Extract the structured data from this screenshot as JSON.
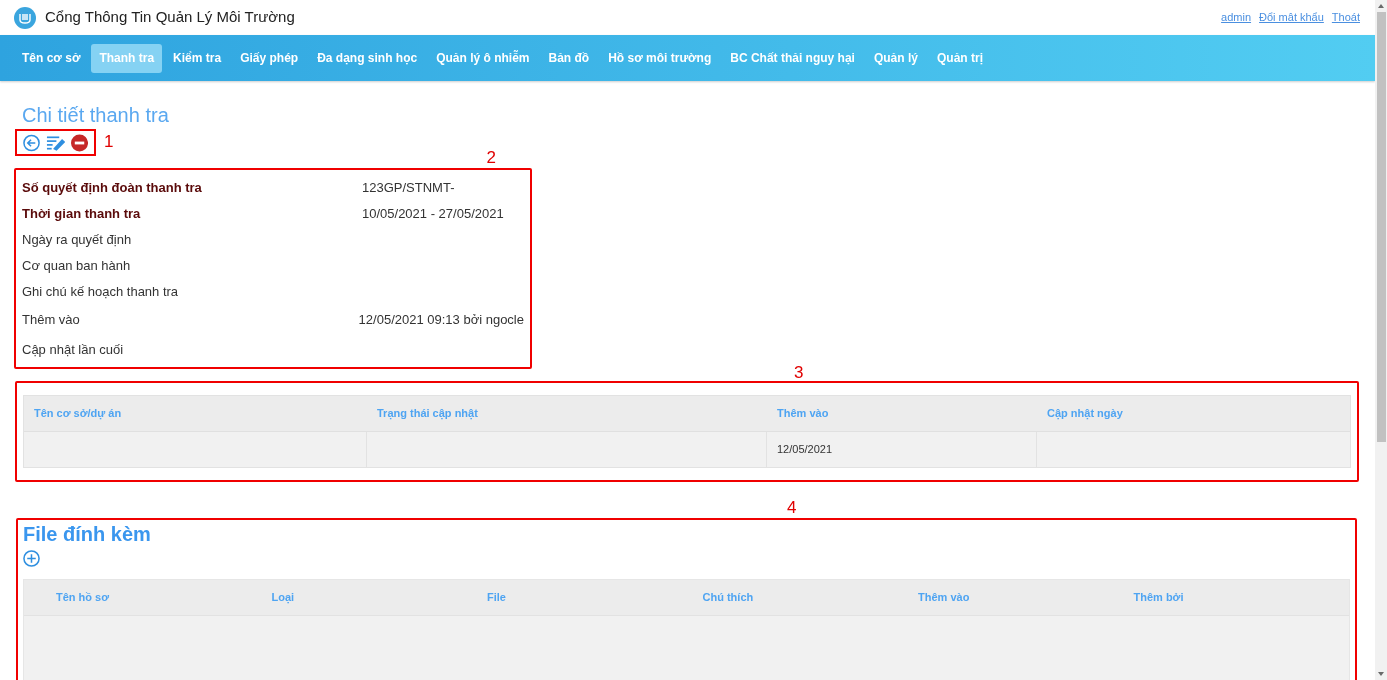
{
  "header": {
    "title": "Cổng Thông Tin Quản Lý Môi Trường",
    "links": [
      "admin",
      "Đổi mật khẩu",
      "Thoát"
    ]
  },
  "nav": [
    {
      "label": "Tên cơ sở",
      "selected": false
    },
    {
      "label": "Thanh tra",
      "selected": true
    },
    {
      "label": "Kiểm tra",
      "selected": false
    },
    {
      "label": "Giấy phép",
      "selected": false
    },
    {
      "label": "Đa dạng sinh học",
      "selected": false
    },
    {
      "label": "Quản lý ô nhiễm",
      "selected": false
    },
    {
      "label": "Bản đồ",
      "selected": false
    },
    {
      "label": "Hồ sơ môi trường",
      "selected": false
    },
    {
      "label": "BC Chất thải nguy hại",
      "selected": false
    },
    {
      "label": "Quản lý",
      "selected": false
    },
    {
      "label": "Quản trị",
      "selected": false
    }
  ],
  "page_title": "Chi tiết thanh tra",
  "toolbar": {
    "annotation": "1"
  },
  "details": {
    "annotation": "2",
    "rows": [
      {
        "label": "Số quyết định đoàn thanh tra",
        "value": "123GP/STNMT-",
        "bold": true
      },
      {
        "label": "Thời gian thanh tra",
        "value": "10/05/2021 - 27/05/2021",
        "bold": true
      },
      {
        "label": "Ngày ra quyết định",
        "bold": false
      },
      {
        "label": "Cơ quan ban hành",
        "bold": false
      },
      {
        "label": "Ghi chú kế hoạch thanh tra",
        "bold": false
      },
      {
        "label": "Thêm vào",
        "value": "12/05/2021 09:13 bởi ngocle",
        "bold": false
      },
      {
        "label": "Cập nhật lần cuối",
        "bold": false
      }
    ]
  },
  "status_table": {
    "annotation": "3",
    "columns": [
      "Tên cơ sở/dự án",
      "Trạng thái cập nhật",
      "Thêm vào",
      "Cập nhật ngày"
    ],
    "rows": [
      [
        null,
        null,
        "12/05/2021",
        null
      ]
    ]
  },
  "attachments": {
    "annotation": "4",
    "title": "File đính kèm",
    "columns": [
      "Tên hồ sơ",
      "Loại",
      "File",
      "Chú thích",
      "Thêm vào",
      "Thêm bởi"
    ]
  }
}
